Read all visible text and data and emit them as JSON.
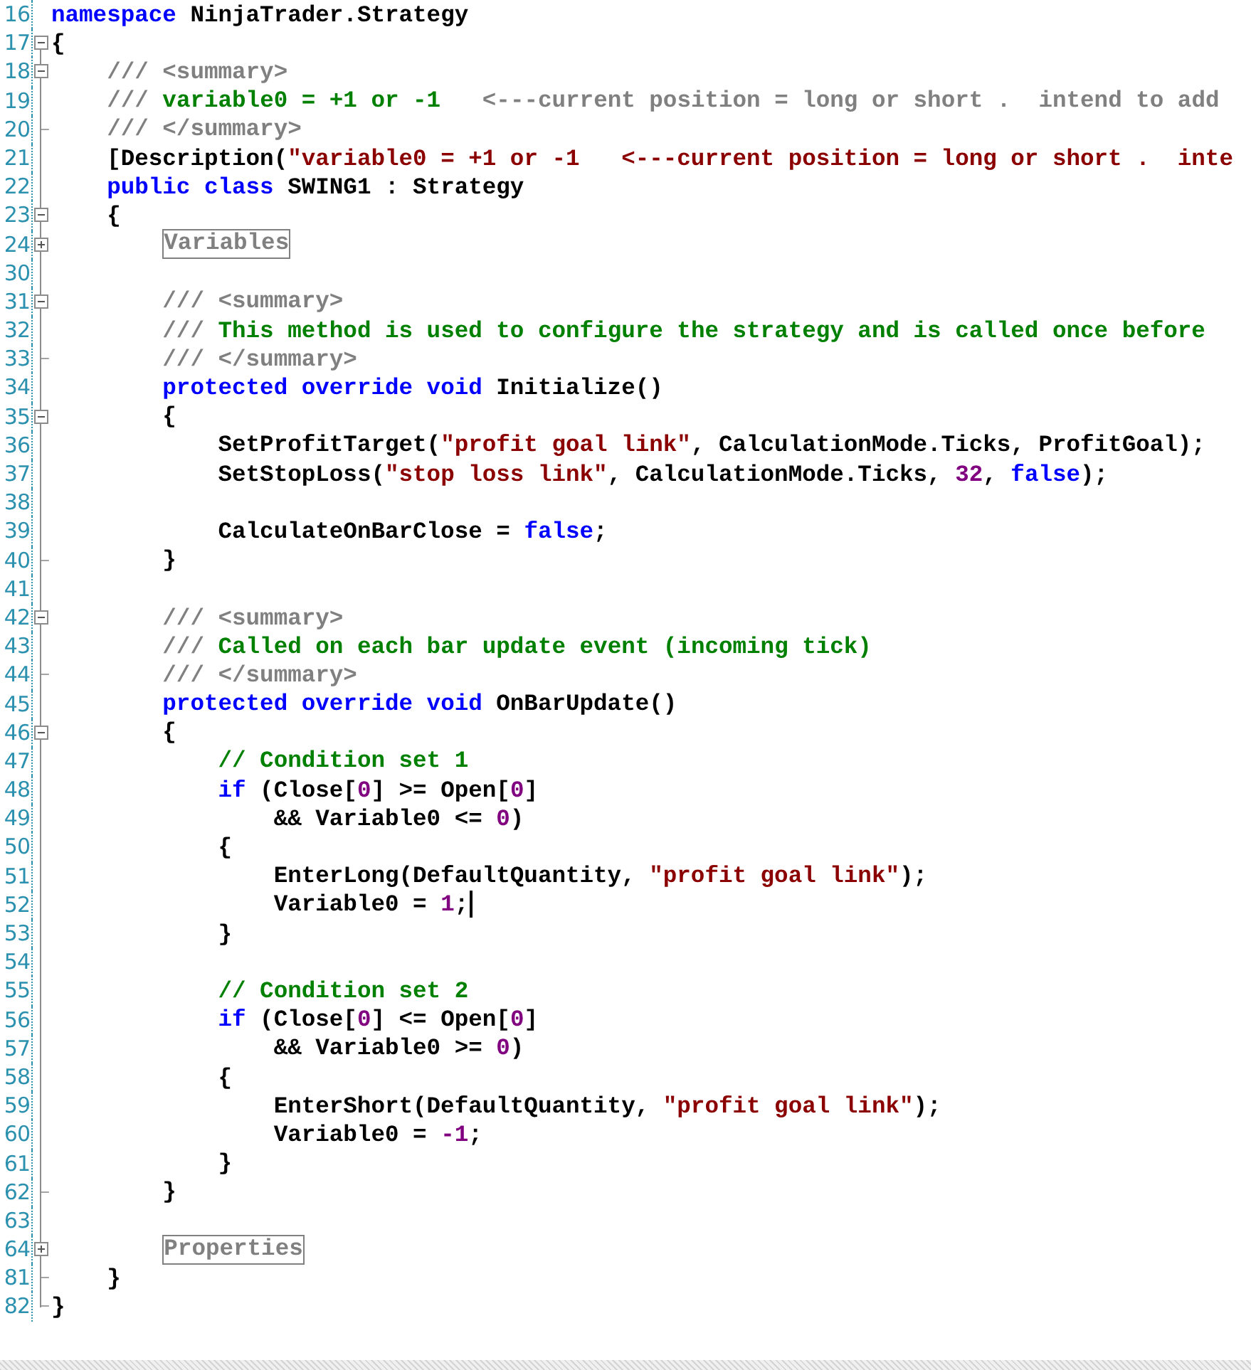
{
  "editor": {
    "lines": [
      {
        "number": "16",
        "kind": "none",
        "cursor": false,
        "tokens": [
          {
            "kind": "keyword",
            "text": "namespace"
          },
          {
            "kind": "plain",
            "text": " NinjaTrader.Strategy"
          }
        ]
      },
      {
        "number": "17",
        "kind": "open",
        "cursor": false,
        "tokens": [
          {
            "kind": "plain",
            "text": "{"
          }
        ]
      },
      {
        "number": "18",
        "kind": "open",
        "cursor": false,
        "tokens": [
          {
            "kind": "doc",
            "text": "    /// <summary>"
          }
        ]
      },
      {
        "number": "19",
        "kind": "inner",
        "cursor": false,
        "tokens": [
          {
            "kind": "doc",
            "text": "    /// "
          },
          {
            "kind": "comment",
            "text": "variable0 = +1 or -1"
          },
          {
            "kind": "doc",
            "text": "   <---current position = long or short .  intend to add"
          }
        ]
      },
      {
        "number": "20",
        "kind": "end",
        "cursor": false,
        "tokens": [
          {
            "kind": "doc",
            "text": "    /// </summary>"
          }
        ]
      },
      {
        "number": "21",
        "kind": "inner",
        "cursor": false,
        "tokens": [
          {
            "kind": "plain",
            "text": "    [Description("
          },
          {
            "kind": "string",
            "text": "\"variable0 = +1 or -1   <---current position = long or short .  inte"
          }
        ]
      },
      {
        "number": "22",
        "kind": "inner",
        "cursor": false,
        "tokens": [
          {
            "kind": "keyword",
            "text": "    public class"
          },
          {
            "kind": "plain",
            "text": " SWING1 : Strategy"
          }
        ]
      },
      {
        "number": "23",
        "kind": "open",
        "cursor": false,
        "tokens": [
          {
            "kind": "plain",
            "text": "    {"
          }
        ]
      },
      {
        "number": "24",
        "kind": "collapsed",
        "cursor": false,
        "tokens": [
          {
            "kind": "region",
            "text": "        Variables"
          }
        ]
      },
      {
        "number": "30",
        "kind": "inner",
        "cursor": false
      },
      {
        "number": "31",
        "kind": "open",
        "cursor": false,
        "tokens": [
          {
            "kind": "doc",
            "text": "        /// <summary>"
          }
        ]
      },
      {
        "number": "32",
        "kind": "inner",
        "cursor": false,
        "tokens": [
          {
            "kind": "doc",
            "text": "        /// "
          },
          {
            "kind": "comment",
            "text": "This method is used to configure the strategy and is called once before"
          }
        ]
      },
      {
        "number": "33",
        "kind": "end",
        "cursor": false,
        "tokens": [
          {
            "kind": "doc",
            "text": "        /// </summary>"
          }
        ]
      },
      {
        "number": "34",
        "kind": "inner",
        "cursor": false,
        "tokens": [
          {
            "kind": "keyword",
            "text": "        protected override void"
          },
          {
            "kind": "plain",
            "text": " Initialize()"
          }
        ]
      },
      {
        "number": "35",
        "kind": "open",
        "cursor": false,
        "tokens": [
          {
            "kind": "plain",
            "text": "        {"
          }
        ]
      },
      {
        "number": "36",
        "kind": "inner",
        "cursor": false,
        "tokens": [
          {
            "kind": "plain",
            "text": "            SetProfitTarget("
          },
          {
            "kind": "string",
            "text": "\"profit goal link\""
          },
          {
            "kind": "plain",
            "text": ", CalculationMode.Ticks, ProfitGoal);"
          }
        ]
      },
      {
        "number": "37",
        "kind": "inner",
        "cursor": false,
        "tokens": [
          {
            "kind": "plain",
            "text": "            SetStopLoss("
          },
          {
            "kind": "string",
            "text": "\"stop loss link\""
          },
          {
            "kind": "plain",
            "text": ", CalculationMode.Ticks, "
          },
          {
            "kind": "number",
            "text": "32"
          },
          {
            "kind": "plain",
            "text": ", "
          },
          {
            "kind": "keyword",
            "text": "false"
          },
          {
            "kind": "plain",
            "text": ");"
          }
        ]
      },
      {
        "number": "38",
        "kind": "inner",
        "cursor": false
      },
      {
        "number": "39",
        "kind": "inner",
        "cursor": false,
        "tokens": [
          {
            "kind": "plain",
            "text": "            CalculateOnBarClose = "
          },
          {
            "kind": "keyword",
            "text": "false"
          },
          {
            "kind": "plain",
            "text": ";"
          }
        ]
      },
      {
        "number": "40",
        "kind": "end",
        "cursor": false,
        "tokens": [
          {
            "kind": "plain",
            "text": "        }"
          }
        ]
      },
      {
        "number": "41",
        "kind": "inner",
        "cursor": false
      },
      {
        "number": "42",
        "kind": "open",
        "cursor": false,
        "tokens": [
          {
            "kind": "doc",
            "text": "        /// <summary>"
          }
        ]
      },
      {
        "number": "43",
        "kind": "inner",
        "cursor": false,
        "tokens": [
          {
            "kind": "doc",
            "text": "        /// "
          },
          {
            "kind": "comment",
            "text": "Called on each bar update event (incoming tick)"
          }
        ]
      },
      {
        "number": "44",
        "kind": "end",
        "cursor": false,
        "tokens": [
          {
            "kind": "doc",
            "text": "        /// </summary>"
          }
        ]
      },
      {
        "number": "45",
        "kind": "inner",
        "cursor": false,
        "tokens": [
          {
            "kind": "keyword",
            "text": "        protected override void"
          },
          {
            "kind": "plain",
            "text": " OnBarUpdate()"
          }
        ]
      },
      {
        "number": "46",
        "kind": "open",
        "cursor": false,
        "tokens": [
          {
            "kind": "plain",
            "text": "        {"
          }
        ]
      },
      {
        "number": "47",
        "kind": "inner",
        "cursor": false,
        "tokens": [
          {
            "kind": "comment",
            "text": "            // Condition set 1"
          }
        ]
      },
      {
        "number": "48",
        "kind": "inner",
        "cursor": false,
        "tokens": [
          {
            "kind": "keyword",
            "text": "            if"
          },
          {
            "kind": "plain",
            "text": " (Close["
          },
          {
            "kind": "number",
            "text": "0"
          },
          {
            "kind": "plain",
            "text": "] >= Open["
          },
          {
            "kind": "number",
            "text": "0"
          },
          {
            "kind": "plain",
            "text": "]"
          }
        ]
      },
      {
        "number": "49",
        "kind": "inner",
        "cursor": false,
        "tokens": [
          {
            "kind": "plain",
            "text": "                && Variable0 <= "
          },
          {
            "kind": "number",
            "text": "0"
          },
          {
            "kind": "plain",
            "text": ")"
          }
        ]
      },
      {
        "number": "50",
        "kind": "inner",
        "cursor": false,
        "tokens": [
          {
            "kind": "plain",
            "text": "            {"
          }
        ]
      },
      {
        "number": "51",
        "kind": "inner",
        "cursor": false,
        "tokens": [
          {
            "kind": "plain",
            "text": "                EnterLong(DefaultQuantity, "
          },
          {
            "kind": "string",
            "text": "\"profit goal link\""
          },
          {
            "kind": "plain",
            "text": ");"
          }
        ]
      },
      {
        "number": "52",
        "kind": "inner",
        "cursor": true,
        "tokens": [
          {
            "kind": "plain",
            "text": "                Variable0 = "
          },
          {
            "kind": "number",
            "text": "1"
          },
          {
            "kind": "plain",
            "text": ";"
          }
        ]
      },
      {
        "number": "53",
        "kind": "inner",
        "cursor": false,
        "tokens": [
          {
            "kind": "plain",
            "text": "            }"
          }
        ]
      },
      {
        "number": "54",
        "kind": "inner",
        "cursor": false
      },
      {
        "number": "55",
        "kind": "inner",
        "cursor": false,
        "tokens": [
          {
            "kind": "comment",
            "text": "            // Condition set 2"
          }
        ]
      },
      {
        "number": "56",
        "kind": "inner",
        "cursor": false,
        "tokens": [
          {
            "kind": "keyword",
            "text": "            if"
          },
          {
            "kind": "plain",
            "text": " (Close["
          },
          {
            "kind": "number",
            "text": "0"
          },
          {
            "kind": "plain",
            "text": "] <= Open["
          },
          {
            "kind": "number",
            "text": "0"
          },
          {
            "kind": "plain",
            "text": "]"
          }
        ]
      },
      {
        "number": "57",
        "kind": "inner",
        "cursor": false,
        "tokens": [
          {
            "kind": "plain",
            "text": "                && Variable0 >= "
          },
          {
            "kind": "number",
            "text": "0"
          },
          {
            "kind": "plain",
            "text": ")"
          }
        ]
      },
      {
        "number": "58",
        "kind": "inner",
        "cursor": false,
        "tokens": [
          {
            "kind": "plain",
            "text": "            {"
          }
        ]
      },
      {
        "number": "59",
        "kind": "inner",
        "cursor": false,
        "tokens": [
          {
            "kind": "plain",
            "text": "                EnterShort(DefaultQuantity, "
          },
          {
            "kind": "string",
            "text": "\"profit goal link\""
          },
          {
            "kind": "plain",
            "text": ");"
          }
        ]
      },
      {
        "number": "60",
        "kind": "inner",
        "cursor": false,
        "tokens": [
          {
            "kind": "plain",
            "text": "                Variable0 = "
          },
          {
            "kind": "number",
            "text": "-1"
          },
          {
            "kind": "plain",
            "text": ";"
          }
        ]
      },
      {
        "number": "61",
        "kind": "inner",
        "cursor": false,
        "tokens": [
          {
            "kind": "plain",
            "text": "            }"
          }
        ]
      },
      {
        "number": "62",
        "kind": "end",
        "cursor": false,
        "tokens": [
          {
            "kind": "plain",
            "text": "        }"
          }
        ]
      },
      {
        "number": "63",
        "kind": "inner",
        "cursor": false
      },
      {
        "number": "64",
        "kind": "collapsed",
        "cursor": false,
        "tokens": [
          {
            "kind": "region",
            "text": "        Properties"
          }
        ]
      },
      {
        "number": "81",
        "kind": "end",
        "cursor": false,
        "tokens": [
          {
            "kind": "plain",
            "text": "    }"
          }
        ]
      },
      {
        "number": "82",
        "kind": "end",
        "cursor": false,
        "tokens": [
          {
            "kind": "plain",
            "text": "}"
          }
        ]
      }
    ]
  }
}
